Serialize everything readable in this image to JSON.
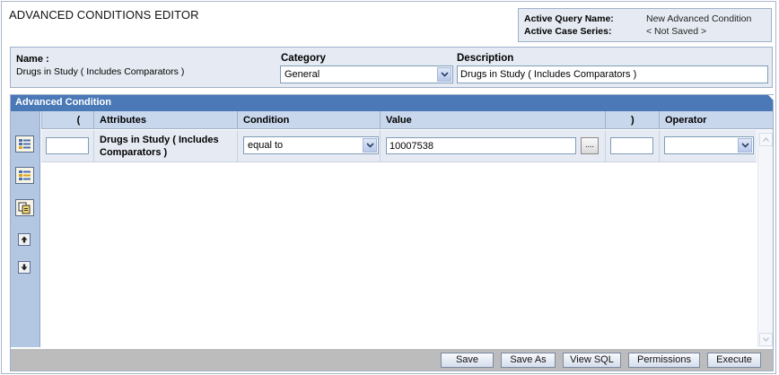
{
  "page": {
    "title": "ADVANCED CONDITIONS EDITOR"
  },
  "query_info": {
    "query_label": "Active Query Name:",
    "query_value": "New Advanced Condition",
    "case_label": "Active Case Series:",
    "case_value": "< Not Saved >"
  },
  "name_panel": {
    "name_label": "Name :",
    "name_value": "Drugs in Study ( Includes Comparators )",
    "category_label": "Category",
    "category_value": "General",
    "description_label": "Description",
    "description_value": "Drugs in Study ( Includes Comparators )"
  },
  "advanced": {
    "header": "Advanced Condition",
    "columns": [
      "(",
      "Attributes",
      "Condition",
      "Value",
      ")",
      "Operator"
    ],
    "rows": [
      {
        "open_paren": "",
        "attribute_line1": "Drugs in Study ( Includes",
        "attribute_line2": "Comparators )",
        "condition": "equal to",
        "value": "10007538",
        "value_button": "....",
        "close_paren": "",
        "operator": ""
      }
    ]
  },
  "toolbar": {
    "save": "Save",
    "save_as": "Save As",
    "view_sql": "View SQL",
    "permissions": "Permissions",
    "execute": "Execute"
  },
  "icons": {
    "add_condition": "add-condition-icon",
    "insert_condition": "insert-condition-icon",
    "copy_condition": "copy-condition-icon",
    "move_up": "arrow-up-icon",
    "move_down": "arrow-down-icon"
  },
  "colors": {
    "header_blue": "#4b79b7",
    "panel_bg": "#e6ebf3",
    "grid_header": "#c8d7ec",
    "rail": "#b3c7e3",
    "footer": "#bcbcbc"
  }
}
